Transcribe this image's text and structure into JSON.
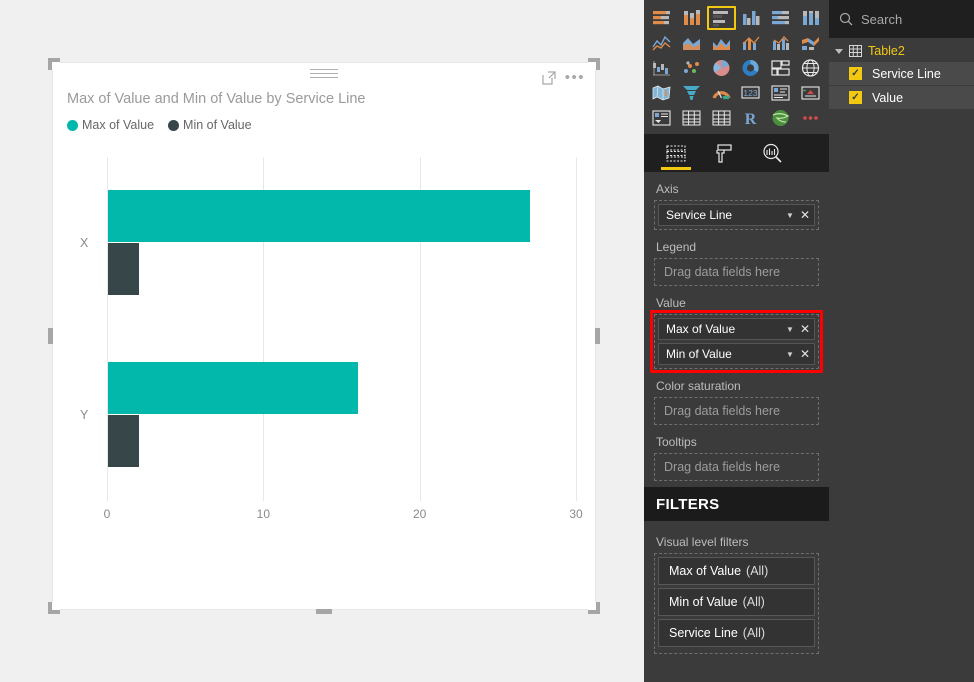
{
  "visual": {
    "title": "Max of Value and Min of Value by Service Line",
    "focus_icon": "focus-mode-icon",
    "more_icon": "ellipsis-icon",
    "drag_handle_icon": "drag-handle-icon"
  },
  "chart_data": {
    "type": "bar",
    "orientation": "horizontal",
    "title": "Max of Value and Min of Value by Service Line",
    "xlabel": "",
    "ylabel": "",
    "categories": [
      "X",
      "Y"
    ],
    "series": [
      {
        "name": "Max of Value",
        "values": [
          27,
          16
        ],
        "color": "#01B8AA"
      },
      {
        "name": "Min of Value",
        "values": [
          2,
          2
        ],
        "color": "#374649"
      }
    ],
    "xlim": [
      0,
      30
    ],
    "xticks": [
      0,
      10,
      20,
      30
    ],
    "xtick_labels": [
      "0",
      "10",
      "20",
      "30"
    ],
    "grid": true,
    "legend_position": "top-left"
  },
  "viz_pane": {
    "gallery": [
      "stacked-bar-chart-icon",
      "stacked-column-chart-icon",
      "clustered-bar-chart-icon",
      "clustered-column-chart-icon",
      "hundred-percent-stacked-bar-chart-icon",
      "hundred-percent-stacked-column-chart-icon",
      "line-chart-icon",
      "area-chart-icon",
      "stacked-area-chart-icon",
      "line-and-stacked-column-chart-icon",
      "line-and-clustered-column-chart-icon",
      "ribbon-chart-icon",
      "waterfall-chart-icon",
      "scatter-chart-icon",
      "pie-chart-icon",
      "donut-chart-icon",
      "treemap-icon",
      "map-icon",
      "filled-map-icon",
      "funnel-icon",
      "gauge-icon",
      "card-icon",
      "multi-row-card-icon",
      "kpi-icon",
      "slicer-icon",
      "table-icon",
      "matrix-icon",
      "r-script-visual-icon",
      "arcgis-maps-icon",
      "more-visuals-icon"
    ],
    "selected_index": 2,
    "tabs": [
      {
        "name": "fields-tab",
        "icon": "fields-icon",
        "active": true
      },
      {
        "name": "format-tab",
        "icon": "paint-roller-icon",
        "active": false
      },
      {
        "name": "analytics-tab",
        "icon": "analytics-magnifier-icon",
        "active": false
      }
    ],
    "wells": [
      {
        "label": "Axis",
        "highlighted": false,
        "fields": [
          {
            "name": "Service Line"
          }
        ],
        "placeholder": ""
      },
      {
        "label": "Legend",
        "highlighted": false,
        "fields": [],
        "placeholder": "Drag data fields here"
      },
      {
        "label": "Value",
        "highlighted": true,
        "fields": [
          {
            "name": "Max of Value"
          },
          {
            "name": "Min of Value"
          }
        ],
        "placeholder": ""
      },
      {
        "label": "Color saturation",
        "highlighted": false,
        "fields": [],
        "placeholder": "Drag data fields here"
      },
      {
        "label": "Tooltips",
        "highlighted": false,
        "fields": [],
        "placeholder": "Drag data fields here"
      }
    ],
    "filters": {
      "header": "FILTERS",
      "subheader": "Visual level filters",
      "cards": [
        {
          "field": "Max of Value",
          "scope": "(All)"
        },
        {
          "field": "Min of Value",
          "scope": "(All)"
        },
        {
          "field": "Service Line",
          "scope": "(All)"
        }
      ]
    }
  },
  "fields_pane": {
    "search": {
      "placeholder": "Search",
      "value": "",
      "icon": "search-icon"
    },
    "table": {
      "name": "Table2",
      "icon": "table-icon",
      "expanded": true,
      "fields": [
        {
          "name": "Service Line",
          "checked": true
        },
        {
          "name": "Value",
          "checked": true
        }
      ]
    }
  },
  "colors": {
    "accent": "#01B8AA",
    "secondary": "#374649",
    "highlight": "#ff0000",
    "brand_yellow": "#f2c811",
    "panel_bg": "#3b3b3b",
    "canvas_bg": "#f0f0f0"
  }
}
